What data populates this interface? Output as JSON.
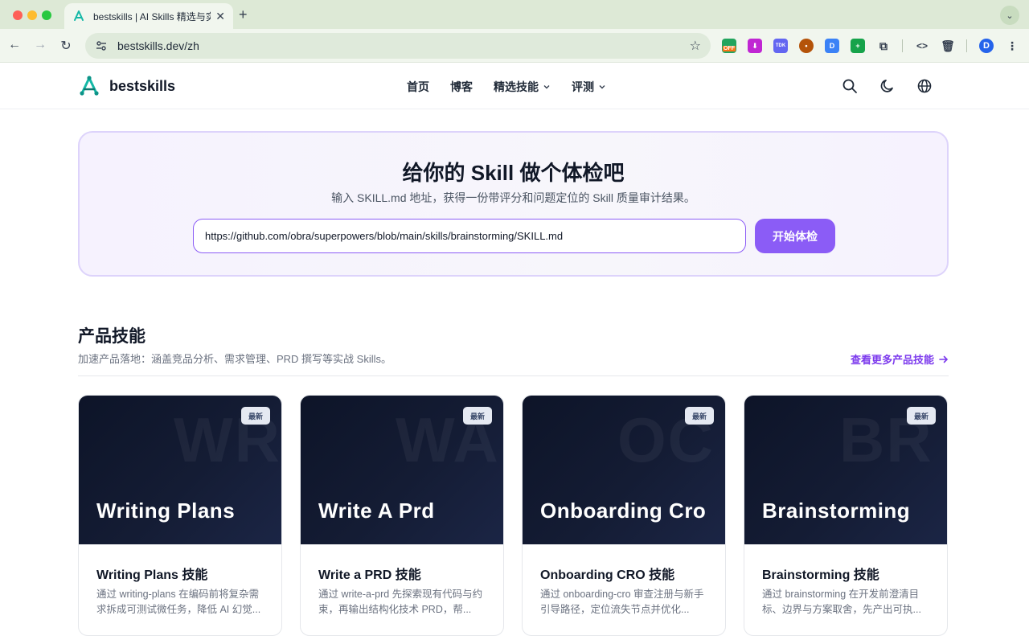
{
  "browser": {
    "tab_title": "bestskills | AI Skills 精选与实战",
    "url": "bestskills.dev/zh",
    "ext_off_label": "OFF",
    "ext_tdk_label": "TDK",
    "profile_letter": "D"
  },
  "site": {
    "logo_text": "bestskills",
    "nav": [
      {
        "label": "首页",
        "has_dropdown": false
      },
      {
        "label": "博客",
        "has_dropdown": false
      },
      {
        "label": "精选技能",
        "has_dropdown": true
      },
      {
        "label": "评测",
        "has_dropdown": true
      }
    ]
  },
  "audit": {
    "title": "给你的 Skill 做个体检吧",
    "subtitle": "输入 SKILL.md 地址，获得一份带评分和问题定位的 Skill 质量审计结果。",
    "input_value": "https://github.com/obra/superpowers/blob/main/skills/brainstorming/SKILL.md",
    "button_label": "开始体检"
  },
  "section": {
    "title": "产品技能",
    "description": "加速产品落地：涵盖竞品分析、需求管理、PRD 撰写等实战 Skills。",
    "more_label": "查看更多产品技能"
  },
  "cards": [
    {
      "badge": "最新",
      "watermark": "WR",
      "cover_title": "Writing Plans",
      "name": "Writing Plans 技能",
      "description": "通过 writing-plans 在编码前将复杂需求拆成可测试微任务，降低 AI 幻觉..."
    },
    {
      "badge": "最新",
      "watermark": "WA",
      "cover_title": "Write A Prd",
      "name": "Write a PRD 技能",
      "description": "通过 write-a-prd 先探索现有代码与约束，再输出结构化技术 PRD，帮..."
    },
    {
      "badge": "最新",
      "watermark": "OC",
      "cover_title": "Onboarding Cro",
      "name": "Onboarding CRO 技能",
      "description": "通过 onboarding-cro 审查注册与新手引导路径，定位流失节点并优化..."
    },
    {
      "badge": "最新",
      "watermark": "BR",
      "cover_title": "Brainstorming",
      "name": "Brainstorming 技能",
      "description": "通过 brainstorming 在开发前澄清目标、边界与方案取舍，先产出可执..."
    }
  ],
  "colors": {
    "accent": "#8b5cf6",
    "accent_text": "#7c3aed",
    "card_cover": "#0d1428",
    "tab_strip": "#dde9d6"
  }
}
